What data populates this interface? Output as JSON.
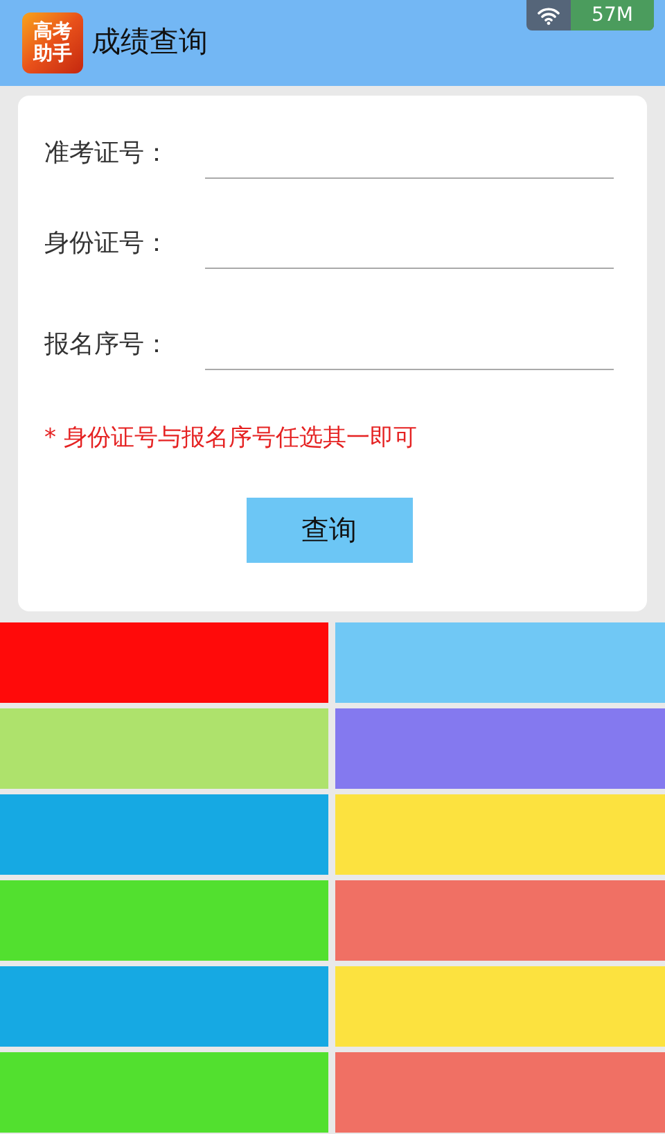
{
  "status_bar": {
    "memory": "57M"
  },
  "header": {
    "logo_text": "高考助手",
    "title": "成绩查询"
  },
  "form": {
    "fields": [
      {
        "label": "准考证号："
      },
      {
        "label": "身份证号："
      },
      {
        "label": "报名序号："
      }
    ],
    "hint": "* 身份证号与报名序号任选其一即可",
    "button": "查询"
  },
  "tiles": [
    {
      "color": "#ff0a0a"
    },
    {
      "color": "#70c8f5"
    },
    {
      "color": "#aee26c"
    },
    {
      "color": "#8479ef"
    },
    {
      "color": "#16a9e3"
    },
    {
      "color": "#fce23f"
    },
    {
      "color": "#52e02f"
    },
    {
      "color": "#f07064"
    },
    {
      "color": "#16a9e3"
    },
    {
      "color": "#fce23f"
    },
    {
      "color": "#52e02f"
    },
    {
      "color": "#f07064"
    }
  ]
}
